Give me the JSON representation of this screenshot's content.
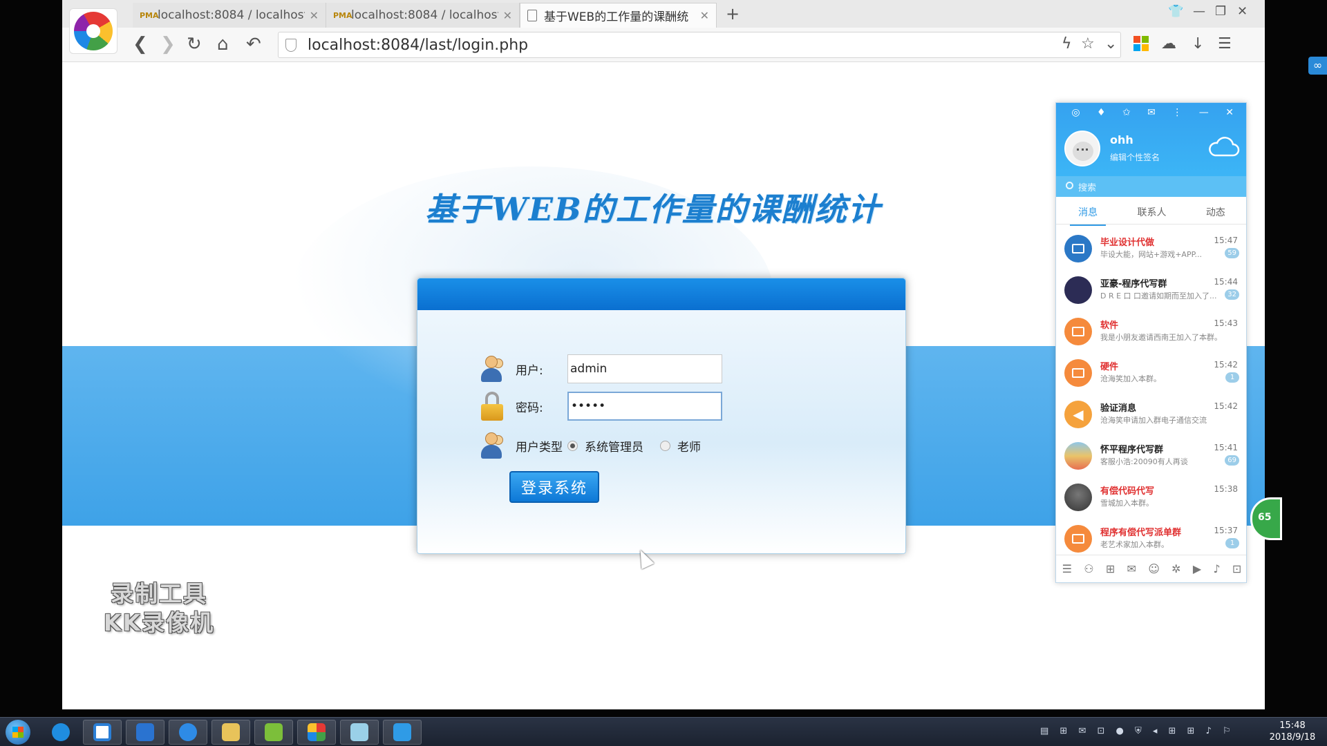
{
  "browser": {
    "tabs": [
      {
        "icon_text": "PMA",
        "title": "localhost:8084 / localhost",
        "active": false
      },
      {
        "icon_text": "PMA",
        "title": "localhost:8084 / localhost",
        "active": false
      },
      {
        "icon_text": "",
        "title": "基于WEB的工作量的课酬统",
        "active": true
      }
    ],
    "url": "localhost:8084/last/login.php"
  },
  "page": {
    "title": "基于WEB的工作量的课酬统计",
    "form": {
      "user_label": "用户:",
      "user_value": "admin",
      "password_label": "密码:",
      "password_value": "•••••",
      "usertype_label": "用户类型",
      "options": [
        {
          "label": "系统管理员",
          "selected": true
        },
        {
          "label": "老师",
          "selected": false
        }
      ],
      "submit_label": "登录系统"
    },
    "watermark_line1": "录制工具",
    "watermark_line2": "KK录像机"
  },
  "qq": {
    "username": "ohh",
    "signature": "编辑个性签名",
    "search_placeholder": "搜索",
    "tabs": [
      "消息",
      "联系人",
      "动态"
    ],
    "messages": [
      {
        "name": "毕业设计代做",
        "preview": "毕设大能，网站+游戏+APP...",
        "time": "15:47",
        "badge": "59",
        "red": true,
        "color": "#2b78c6"
      },
      {
        "name": "亚豪-程序代写群",
        "preview": "D R E 口 口邀请如期而至加入了...",
        "time": "15:44",
        "badge": "32",
        "red": false,
        "color": "#2c2c55"
      },
      {
        "name": "软件",
        "preview": "我是小朋友邀请西南王加入了本群。",
        "time": "15:43",
        "badge": "",
        "red": true,
        "color": "#f58a3c"
      },
      {
        "name": "硬件",
        "preview": "沧海笑加入本群。",
        "time": "15:42",
        "badge": "1",
        "red": true,
        "color": "#f58a3c"
      },
      {
        "name": "验证消息",
        "preview": "沧海笑申请加入群电子通信交流",
        "time": "15:42",
        "badge": "",
        "red": false,
        "color": "#f5a23c"
      },
      {
        "name": "怀平程序代写群",
        "preview": "客服小浩:20090有人再谈",
        "time": "15:41",
        "badge": "69",
        "red": false,
        "color": "#8fc7e8"
      },
      {
        "name": "有偿代码代写",
        "preview": "雪城加入本群。",
        "time": "15:38",
        "badge": "",
        "red": true,
        "color": "#555555"
      },
      {
        "name": "程序有偿代写派单群",
        "preview": "老艺术家加入本群。",
        "time": "15:37",
        "badge": "1",
        "red": true,
        "color": "#f58a3c"
      }
    ]
  },
  "side_badge": "65",
  "taskbar": {
    "time": "15:48",
    "date": "2018/9/18"
  }
}
